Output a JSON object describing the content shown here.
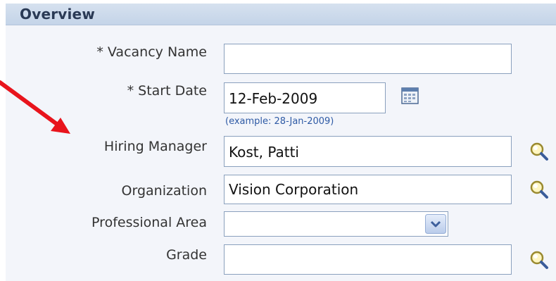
{
  "section": {
    "title": "Overview"
  },
  "form": {
    "vacancy_name": {
      "label": "* Vacancy Name",
      "value": ""
    },
    "start_date": {
      "label": "* Start Date",
      "value": "12-Feb-2009",
      "hint": "(example: 28-Jan-2009)"
    },
    "hiring_manager": {
      "label": "Hiring Manager",
      "value": "Kost, Patti"
    },
    "organization": {
      "label": "Organization",
      "value": "Vision Corporation"
    },
    "professional_area": {
      "label": "Professional Area",
      "value": ""
    },
    "grade": {
      "label": "Grade",
      "value": ""
    }
  },
  "icons": {
    "calendar": "calendar-icon",
    "search": "magnifier-icon",
    "dropdown": "chevron-down-icon"
  },
  "colors": {
    "header_bg": "#c8d6ea",
    "panel_bg": "#f3f5fa",
    "annotation_arrow": "#e8141c",
    "hint_text": "#2e5aa5"
  }
}
